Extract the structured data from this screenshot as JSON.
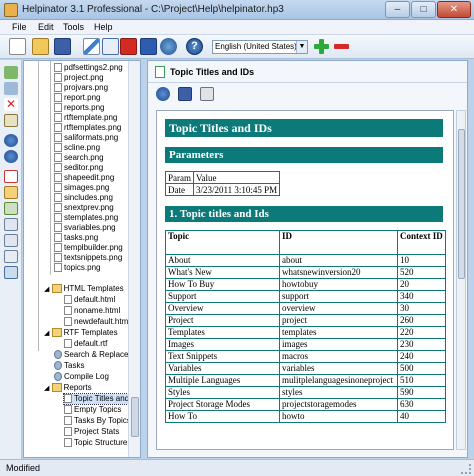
{
  "window": {
    "title": "Helpinator 3.1 Professional - C:\\Project\\Help\\helpinator.hp3"
  },
  "menu": [
    "File",
    "Edit",
    "Tools",
    "Help"
  ],
  "toolbar": {
    "language": "English (United States)",
    "icons": [
      "new-document-icon",
      "open-folder-icon",
      "save-icon",
      "pencil-icon",
      "html-export-icon",
      "pdf-icon",
      "word-icon",
      "globe-icon",
      "help-icon",
      "add-icon",
      "remove-icon"
    ]
  },
  "tree": {
    "items": [
      {
        "label": "pdfsettings2.png"
      },
      {
        "label": "project.png"
      },
      {
        "label": "projvars.png"
      },
      {
        "label": "report.png"
      },
      {
        "label": "reports.png"
      },
      {
        "label": "rtftemplate.png"
      },
      {
        "label": "rtftemplates.png"
      },
      {
        "label": "saliformats.png"
      },
      {
        "label": "scline.png"
      },
      {
        "label": "search.png"
      },
      {
        "label": "seditor.png"
      },
      {
        "label": "shapeedit.png"
      },
      {
        "label": "simages.png"
      },
      {
        "label": "sincludes.png"
      },
      {
        "label": "snextprev.png"
      },
      {
        "label": "stemplates.png"
      },
      {
        "label": "svariables.png"
      },
      {
        "label": "tasks.png"
      },
      {
        "label": "templbuilder.png"
      },
      {
        "label": "textsnippets.png"
      },
      {
        "label": "topics.png"
      },
      {
        "label": "HTML Templates"
      },
      {
        "label": "default.html"
      },
      {
        "label": "noname.html"
      },
      {
        "label": "newdefault.html"
      },
      {
        "label": "RTF Templates"
      },
      {
        "label": "default.rtf"
      },
      {
        "label": "Search & Replace"
      },
      {
        "label": "Tasks"
      },
      {
        "label": "Compile Log"
      },
      {
        "label": "Reports"
      },
      {
        "label": "Topic Titles and IDs"
      },
      {
        "label": "Empty Topics"
      },
      {
        "label": "Tasks By Topics"
      },
      {
        "label": "Project Stats"
      },
      {
        "label": "Topic Structure"
      }
    ]
  },
  "pane": {
    "title": "Topic Titles and IDs"
  },
  "doc": {
    "heading": "Topic Titles and IDs",
    "params_heading": "Parameters",
    "params_header": [
      "Param",
      "Value"
    ],
    "params_rows": [
      [
        "Date",
        "3/23/2011 3:10:45 PM"
      ]
    ],
    "section_heading": "1. Topic titles and Ids",
    "topics_header": [
      "Topic",
      "ID",
      "Context ID"
    ],
    "topics_rows": [
      [
        "About",
        "about",
        "10"
      ],
      [
        "What's New",
        "whatsnewinversion20",
        "520"
      ],
      [
        "How To Buy",
        "howtobuy",
        "20"
      ],
      [
        "Support",
        "support",
        "340"
      ],
      [
        "Overview",
        "overview",
        "30"
      ],
      [
        "Project",
        "project",
        "260"
      ],
      [
        "Templates",
        "templates",
        "220"
      ],
      [
        "Images",
        "images",
        "230"
      ],
      [
        "Text Snippets",
        "macros",
        "240"
      ],
      [
        "Variables",
        "variables",
        "500"
      ],
      [
        "Multiple Languages",
        "mulitplelanguagesinoneproject",
        "510"
      ],
      [
        "Styles",
        "styles",
        "590"
      ],
      [
        "Project Storage Modes",
        "projectstoragemodes",
        "630"
      ],
      [
        "How To",
        "howto",
        "40"
      ]
    ]
  },
  "status": {
    "text": "Modified"
  },
  "colors": {
    "heading_bg": "#0c7a78",
    "window_bg": "#bcd2ea"
  }
}
